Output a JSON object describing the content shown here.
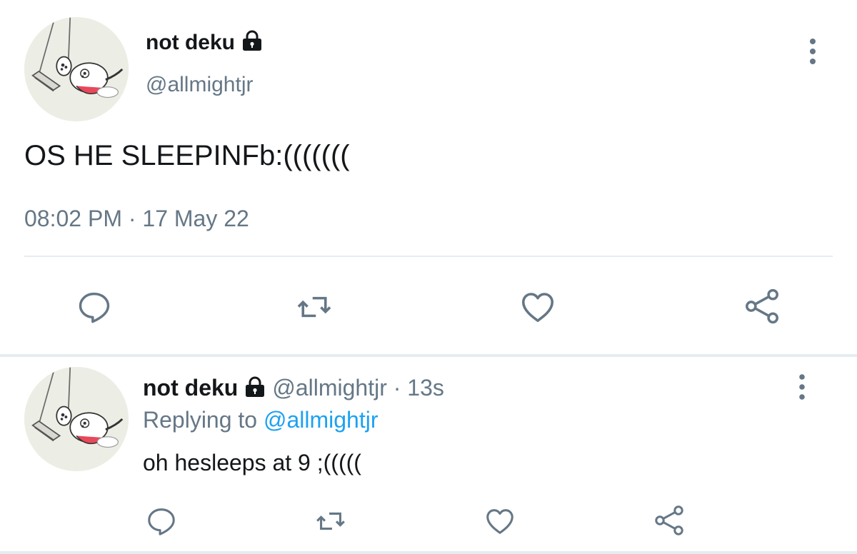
{
  "tweet": {
    "author_name": "not deku",
    "handle": "@allmightjr",
    "text": "OS HE SLEEPINFb:(((((((",
    "timestamp": "08:02 PM · 17 May 22",
    "actions": [
      "reply-icon",
      "retweet-icon",
      "like-icon",
      "share-icon"
    ]
  },
  "reply": {
    "author_name": "not deku",
    "handle_time": "@allmightjr · 13s",
    "replying_prefix": "Replying to",
    "replying_to": "@allmightjr",
    "text": "oh hesleeps at 9 ;(((((",
    "actions": [
      "reply-icon",
      "retweet-icon",
      "like-icon",
      "share-icon"
    ]
  },
  "colors": {
    "text_primary": "#14171a",
    "text_secondary": "#657786",
    "mention_blue": "#1da1f2",
    "icon_gray": "#657786",
    "divider": "#e6ecf0"
  }
}
